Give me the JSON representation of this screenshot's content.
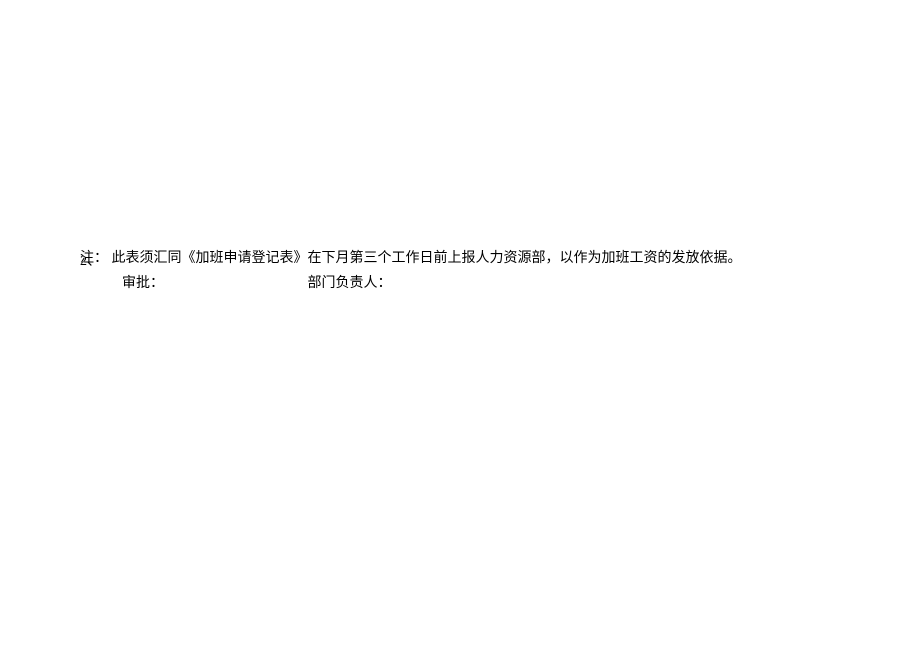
{
  "note": {
    "prefix_main": "注：",
    "prefix_overlay": "2、",
    "text": "此表须汇同《加班申请登记表》在下月第三个工作日前上报人力资源部，以作为加班工资的发放依据。"
  },
  "signatures": {
    "approval_label": "审批：",
    "dept_head_label": "部门负责人："
  }
}
